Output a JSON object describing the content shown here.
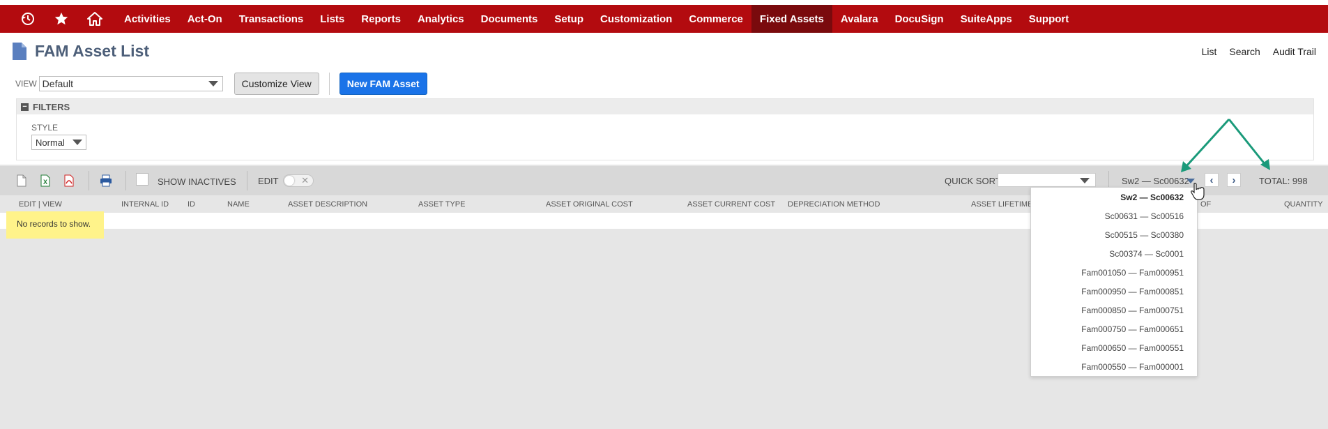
{
  "nav": {
    "items": [
      "Activities",
      "Act-On",
      "Transactions",
      "Lists",
      "Reports",
      "Analytics",
      "Documents",
      "Setup",
      "Customization",
      "Commerce",
      "Fixed Assets",
      "Avalara",
      "DocuSign",
      "SuiteApps",
      "Support"
    ],
    "active": "Fixed Assets"
  },
  "page": {
    "title": "FAM Asset List",
    "links": [
      "List",
      "Search",
      "Audit Trail"
    ]
  },
  "view": {
    "label": "VIEW",
    "selected": "Default",
    "customize_label": "Customize View",
    "new_label": "New FAM Asset"
  },
  "filters": {
    "title": "FILTERS",
    "style_label": "STYLE",
    "style_value": "Normal"
  },
  "toolbar": {
    "show_inactives": "SHOW INACTIVES",
    "edit_label": "EDIT",
    "quick_sort_label": "QUICK SORT",
    "range": "Sw2 — Sc00632",
    "total": "TOTAL: 998"
  },
  "columns": [
    "EDIT | VIEW",
    "INTERNAL ID",
    "ID",
    "NAME",
    "ASSET DESCRIPTION",
    "ASSET TYPE",
    "ASSET ORIGINAL COST",
    "ASSET CURRENT COST",
    "DEPRECIATION METHOD",
    "ASSET LIFETIME",
    "OF",
    "QUANTITY"
  ],
  "empty_message": "No records to show.",
  "range_dropdown": [
    "Sw2 — Sc00632",
    "Sc00631 — Sc00516",
    "Sc00515 — Sc00380",
    "Sc00374 — Sc0001",
    "Fam001050 — Fam000951",
    "Fam000950 — Fam000851",
    "Fam000850 — Fam000751",
    "Fam000750 — Fam000651",
    "Fam000650 — Fam000551",
    "Fam000550 — Fam000001"
  ],
  "colors": {
    "nav_bg": "#b30b0f",
    "nav_active": "#7a0a0d",
    "primary_button": "#1a73e8",
    "highlight": "#fff38a",
    "annotation_arrow": "#1a9a7a"
  }
}
